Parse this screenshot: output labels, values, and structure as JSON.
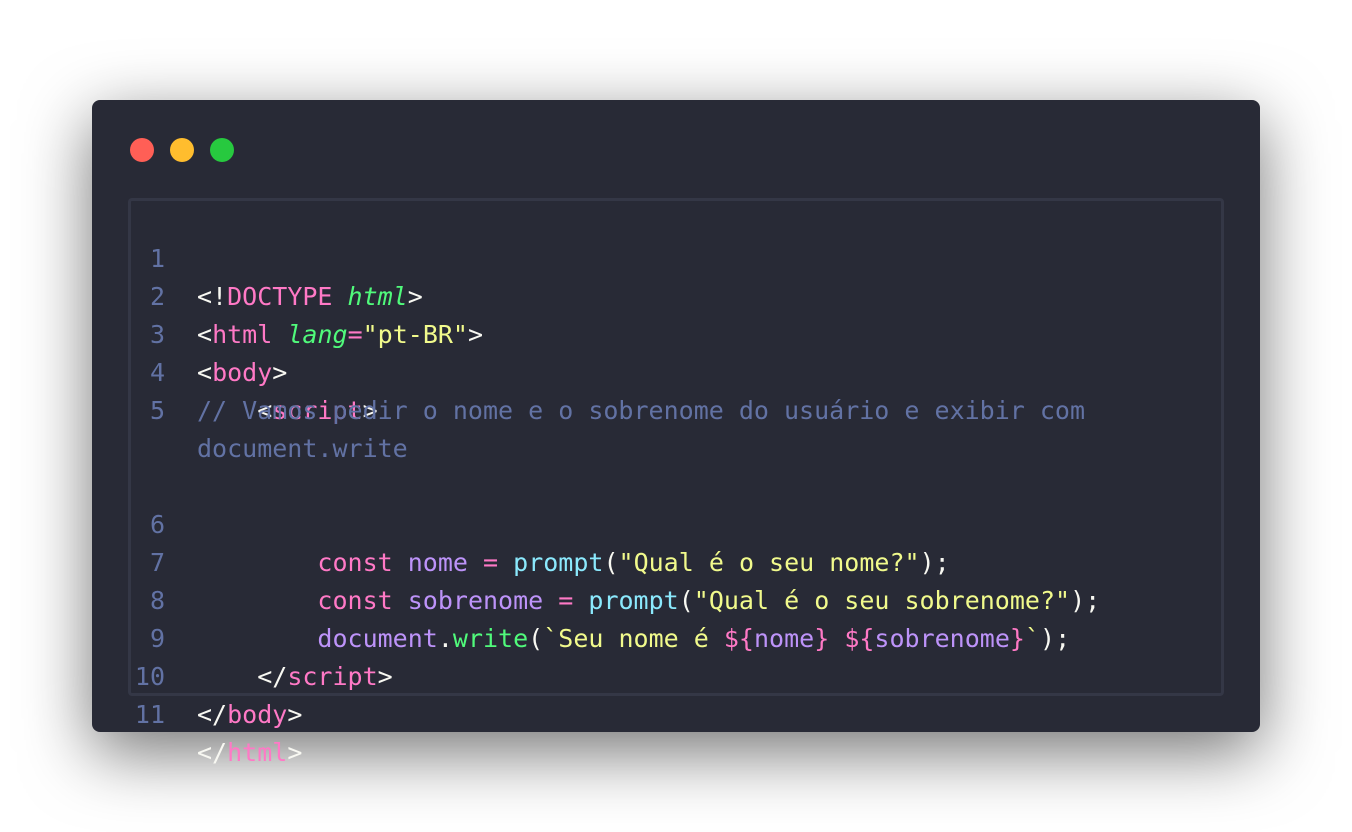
{
  "window": {
    "buttons": [
      "close",
      "minimize",
      "maximize"
    ],
    "colors": {
      "background": "#282a36",
      "close": "#ff5f56",
      "minimize": "#ffbd2e",
      "maximize": "#27c93f"
    }
  },
  "code": {
    "language": "html",
    "line_numbers": [
      "1",
      "2",
      "3",
      "4",
      "5",
      "6",
      "7",
      "8",
      "9",
      "10",
      "11"
    ],
    "lines": [
      {
        "t1": "<!",
        "t2": "DOCTYPE",
        "t3": " ",
        "t4": "html",
        "t5": ">"
      },
      {
        "t1": "<",
        "t2": "html",
        "t3": " ",
        "t4": "lang",
        "t5": "=",
        "t6": "\"pt-BR\"",
        "t7": ">"
      },
      {
        "t1": "<",
        "t2": "body",
        "t3": ">"
      },
      {
        "indent": "    ",
        "t1": "<",
        "t2": "script",
        "t3": ">"
      },
      {
        "comment": "// Vamos pedir o nome e o sobrenome do usuário e exibir com document.write"
      },
      {
        "indent": "        ",
        "t1": "const",
        "t2": " ",
        "t3": "nome",
        "t4": " ",
        "t5": "=",
        "t6": " ",
        "t7": "prompt",
        "t8": "(",
        "t9": "\"Qual é o seu nome?\"",
        "t10": ");"
      },
      {
        "indent": "        ",
        "t1": "const",
        "t2": " ",
        "t3": "sobrenome",
        "t4": " ",
        "t5": "=",
        "t6": " ",
        "t7": "prompt",
        "t8": "(",
        "t9": "\"Qual é o seu sobrenome?\"",
        "t10": ");"
      },
      {
        "indent": "        ",
        "t1": "document",
        "t2": ".",
        "t3": "write",
        "t4": "(",
        "t5": "`Seu nome é ",
        "t6": "${",
        "t7": "nome",
        "t8": "}",
        "t9": " ",
        "t10": "${",
        "t11": "sobrenome",
        "t12": "}",
        "t13": "`",
        "t14": ");"
      },
      {
        "indent": "    ",
        "t1": "</",
        "t2": "script",
        "t3": ">"
      },
      {
        "t1": "</",
        "t2": "body",
        "t3": ">"
      },
      {
        "t1": "</",
        "t2": "html",
        "t3": ">"
      }
    ]
  }
}
